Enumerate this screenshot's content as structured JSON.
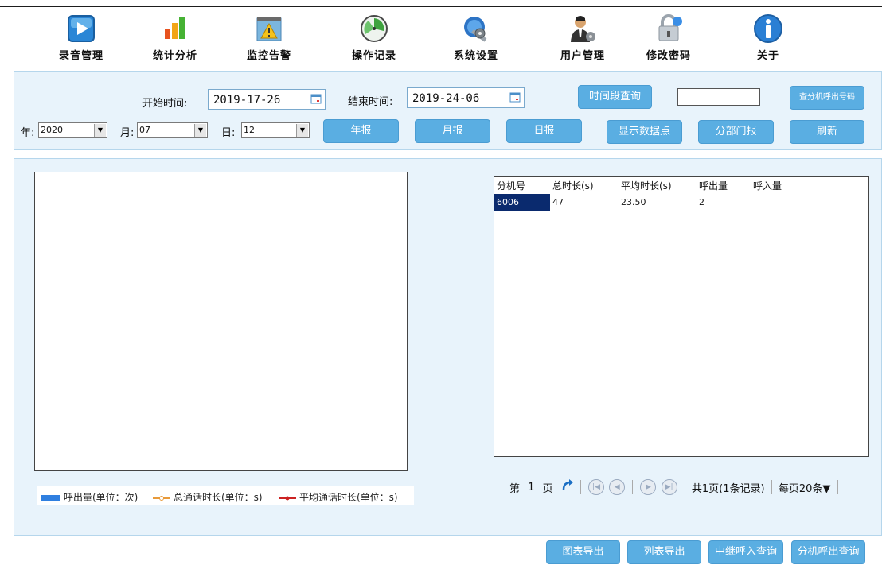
{
  "toolbar": {
    "items": [
      {
        "label": "录音管理",
        "icon": "play-media-icon"
      },
      {
        "label": "统计分析",
        "icon": "bar-chart-icon"
      },
      {
        "label": "监控告警",
        "icon": "warning-icon"
      },
      {
        "label": "操作记录",
        "icon": "clock-log-icon"
      },
      {
        "label": "系统设置",
        "icon": "gear-wrench-icon"
      },
      {
        "label": "用户管理",
        "icon": "user-icon"
      },
      {
        "label": "修改密码",
        "icon": "lock-icon"
      },
      {
        "label": "关于",
        "icon": "info-icon"
      }
    ]
  },
  "query": {
    "start_label": "开始时间:",
    "start_value": "2019-17-26",
    "end_label": "结束时间:",
    "end_value": "2019-24-06",
    "range_query_btn": "时间段查询",
    "ext_query_btn": "查分机呼出号码",
    "year_label": "年:",
    "year_value": "2020",
    "month_label": "月:",
    "month_value": "07",
    "day_label": "日:",
    "day_value": "12",
    "year_report_btn": "年报",
    "month_report_btn": "月报",
    "day_report_btn": "日报",
    "show_points_btn": "显示数据点",
    "dept_report_btn": "分部门报",
    "refresh_btn": "刷新"
  },
  "legend": {
    "calls_out": "呼出量(单位：次)",
    "total_time": "总通话时长(单位：s)",
    "avg_time": "平均通话时长(单位：s)"
  },
  "colors": {
    "accent": "#5aaee2",
    "panel": "#e8f3fb",
    "calls_out": "#2f7fe0",
    "total_time": "#e89a3a",
    "avg_time": "#cc2222"
  },
  "table": {
    "headers": [
      "分机号",
      "总时长(s)",
      "平均时长(s)",
      "呼出量",
      "呼入量"
    ],
    "rows": [
      [
        "6006",
        "47",
        "23.50",
        "2",
        ""
      ]
    ]
  },
  "pager": {
    "page_prefix": "第",
    "page_value": "1",
    "page_suffix": "页",
    "summary": "共1页(1条记录)",
    "per_page": "每页20条▼"
  },
  "bottom": {
    "chart_export": "图表导出",
    "list_export": "列表导出",
    "relay_in_query": "中继呼入查询",
    "ext_out_query": "分机呼出查询"
  }
}
